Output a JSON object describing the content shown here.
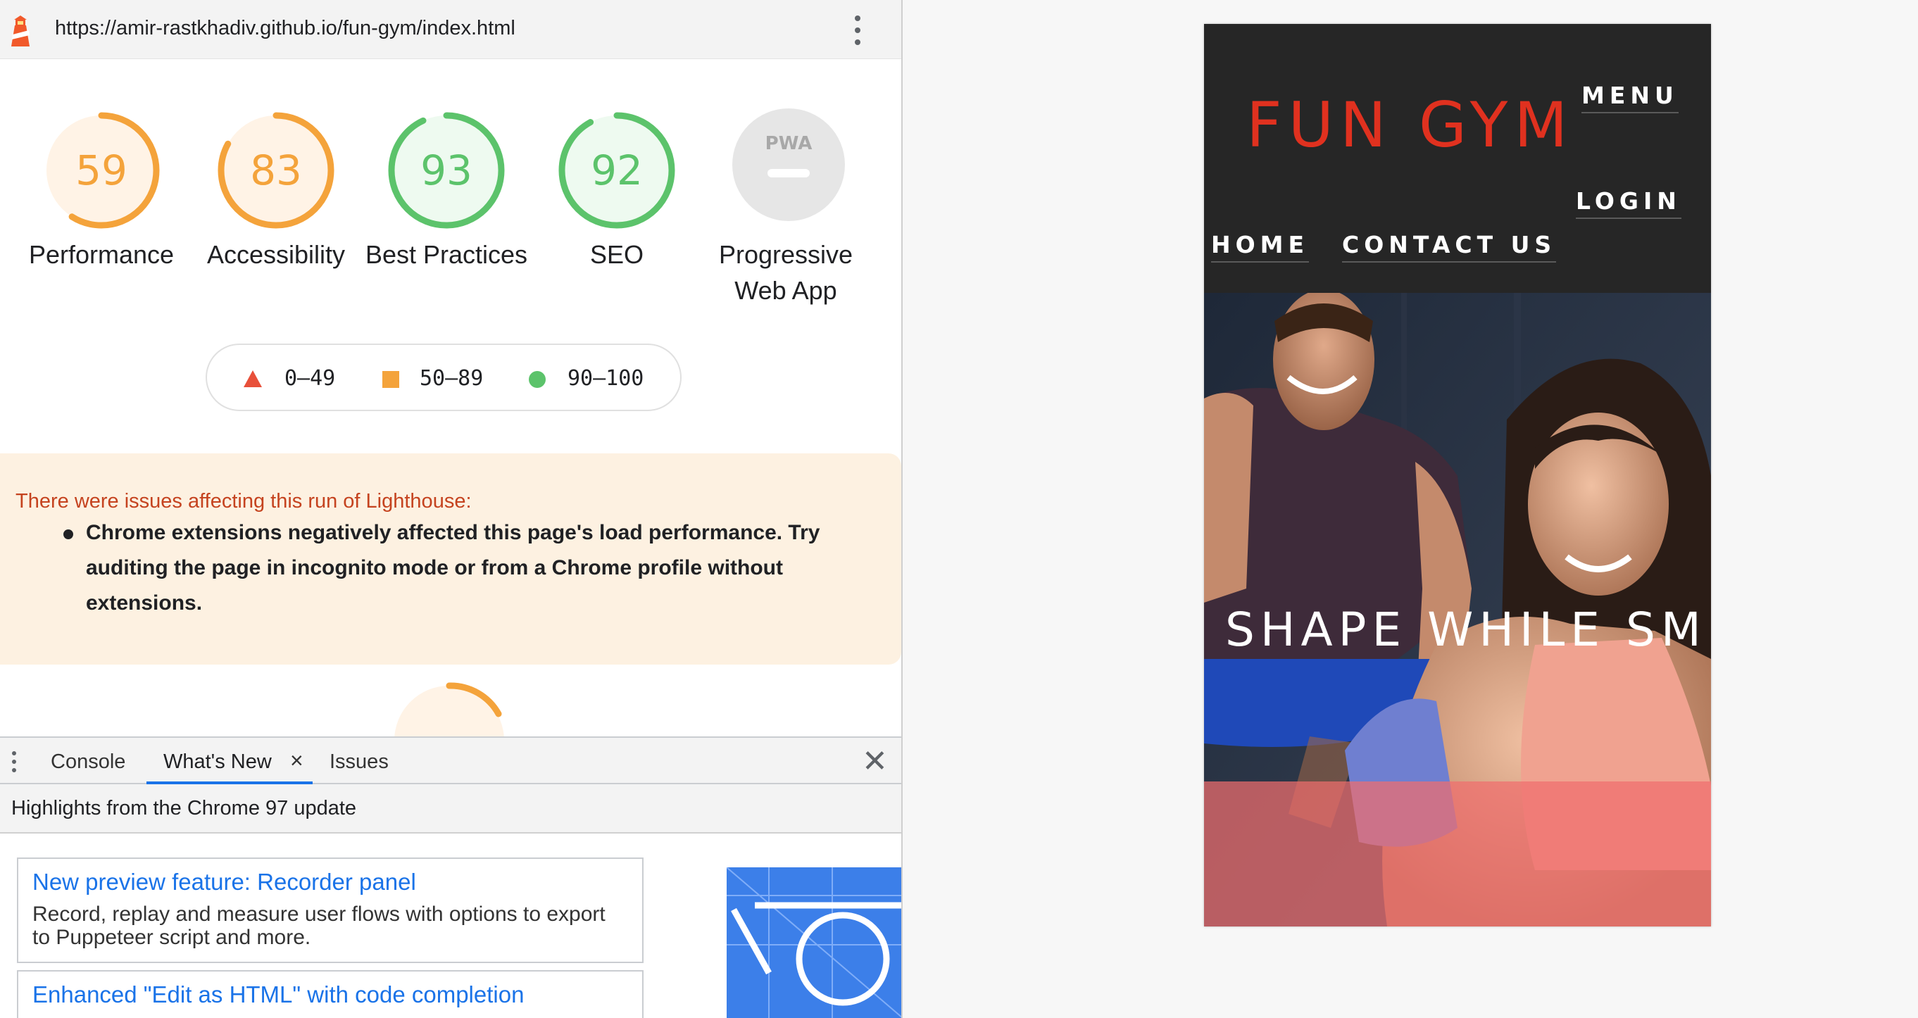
{
  "url_bar": {
    "url": "https://amir-rastkhadiv.github.io/fun-gym/index.html",
    "logo_icon": "lighthouse-icon",
    "menu_icon": "more-vertical-icon"
  },
  "scores": [
    {
      "key": "performance",
      "value": "59",
      "label": "Performance",
      "fraction": 0.59,
      "color": "#f4a33b",
      "bg": "#fff3e6"
    },
    {
      "key": "accessibility",
      "value": "83",
      "label": "Accessibility",
      "fraction": 0.83,
      "color": "#f4a33b",
      "bg": "#fff3e6"
    },
    {
      "key": "best-practices",
      "value": "93",
      "label": "Best Practices",
      "fraction": 0.93,
      "color": "#5cc36b",
      "bg": "#eefaf0"
    },
    {
      "key": "seo",
      "value": "92",
      "label": "SEO",
      "fraction": 0.92,
      "color": "#5cc36b",
      "bg": "#eefaf0"
    }
  ],
  "pwa": {
    "badge": "PWA",
    "label": "Progressive Web App"
  },
  "legend": {
    "fail": {
      "range": "0–49",
      "color": "#e8503a"
    },
    "average": {
      "range": "50–89",
      "color": "#f4a33b"
    },
    "pass": {
      "range": "90–100",
      "color": "#5cc36b"
    }
  },
  "warning": {
    "title": "There were issues affecting this run of Lighthouse:",
    "item": "Chrome extensions negatively affected this page's load performance. Try auditing the page in incognito mode or from a Chrome profile without extensions."
  },
  "drawer": {
    "tabs": {
      "console": "Console",
      "whats_new": "What's New",
      "issues": "Issues"
    },
    "close_tab_glyph": "×",
    "close_drawer_glyph": "✕",
    "highlights": "Highlights from the Chrome 97 update",
    "cards": [
      {
        "title": "New preview feature: Recorder panel",
        "desc": "Record, replay and measure user flows with options to export to Puppeteer script and more."
      },
      {
        "title": "Enhanced \"Edit as HTML\" with code completion"
      }
    ]
  },
  "site": {
    "brand": "FUN GYM",
    "nav": {
      "menu": "MENU",
      "login": "LOGIN",
      "home": "HOME",
      "contact": "CONTACT US"
    },
    "tagline": "SHAPE WHILE SMI"
  }
}
